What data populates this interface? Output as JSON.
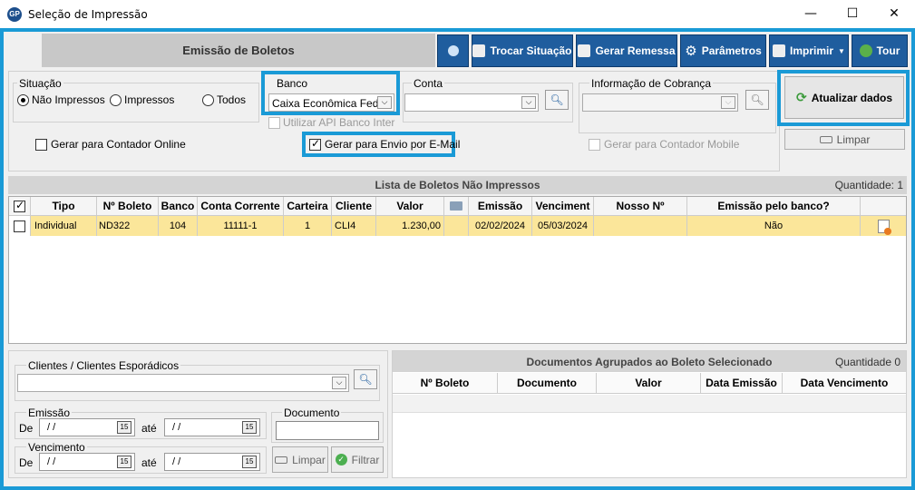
{
  "window": {
    "title": "Seleção de Impressão",
    "icon_text": "GP",
    "minimize": "—",
    "maximize": "☐",
    "close": "✕"
  },
  "header": {
    "title": "Emissão de Boletos"
  },
  "toolbar": {
    "info": "",
    "trocar_situacao": "Trocar Situação",
    "gerar_remessa": "Gerar Remessa",
    "parametros": "Parâmetros",
    "imprimir": "Imprimir",
    "tour": "Tour"
  },
  "situacao": {
    "label": "Situação",
    "options": [
      "Não Impressos",
      "Impressos",
      "Todos"
    ],
    "selected": "Não Impressos"
  },
  "banco": {
    "label": "Banco",
    "value": "Caixa Econômica Feder",
    "api_label": "Utilizar API Banco Inter"
  },
  "conta": {
    "label": "Conta",
    "value": ""
  },
  "info_cobranca": {
    "label": "Informação de Cobrança",
    "value": ""
  },
  "actions": {
    "atualizar": "Atualizar dados",
    "limpar": "Limpar"
  },
  "checks": {
    "contador_online": "Gerar para Contador Online",
    "envio_email": "Gerar para Envio por E-Mail",
    "contador_mobile": "Gerar para Contador Mobile"
  },
  "boletos": {
    "title": "Lista de Boletos Não Impressos",
    "quantity": "Quantidade: 1",
    "columns": [
      "Tipo",
      "Nº Boleto",
      "Banco",
      "Conta Corrente",
      "Carteira",
      "Cliente",
      "Valor",
      "",
      "Emissão",
      "Venciment",
      "Nosso Nº",
      "Emissão pelo banco?"
    ],
    "rows": [
      {
        "tipo": "Individual",
        "boleto": "ND322",
        "banco": "104",
        "conta": "11111-1",
        "carteira": "1",
        "cliente": "CLI4",
        "valor": "1.230,00",
        "emissao": "02/02/2024",
        "vencimento": "05/03/2024",
        "nosso": "",
        "emissao_banco": "Não"
      }
    ]
  },
  "clientes": {
    "label": "Clientes / Clientes Esporádicos",
    "value": ""
  },
  "emissao": {
    "label": "Emissão",
    "de": "De",
    "ate": "até",
    "from": "/ /",
    "to": "/ /"
  },
  "vencimento": {
    "label": "Vencimento",
    "de": "De",
    "ate": "até",
    "from": "/ /",
    "to": "/ /"
  },
  "documento": {
    "label": "Documento",
    "value": ""
  },
  "filters": {
    "limpar": "Limpar",
    "filtrar": "Filtrar"
  },
  "documentos": {
    "title": "Documentos Agrupados ao Boleto Selecionado",
    "quantity": "Quantidade 0",
    "columns": [
      "Nº Boleto",
      "Documento",
      "Valor",
      "Data Emissão",
      "Data Vencimento"
    ]
  },
  "colors": {
    "accent": "#1a9ad6",
    "toolbar": "#1f5d9e",
    "row_highlight": "#fbe69a"
  }
}
